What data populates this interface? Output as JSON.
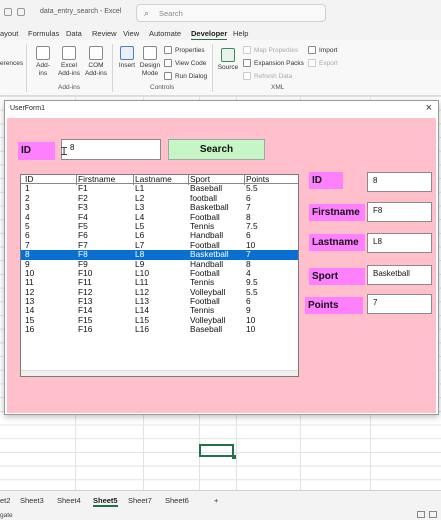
{
  "window": {
    "doc_title": "data_entry_search  -  Excel",
    "search_placeholder": "Search"
  },
  "ribbon_tabs": [
    "ayout",
    "Formulas",
    "Data",
    "Review",
    "View",
    "Automate",
    "Developer",
    "Help"
  ],
  "ribbon": {
    "references": "erences",
    "addins_btn": "Add-\nins",
    "excel_addins_btn": "Excel\nAdd-ins",
    "com_addins_btn": "COM\nAdd-ins",
    "addins_group": "Add-ins",
    "insert_btn": "Insert",
    "design_mode_btn": "Design\nMode",
    "properties": "Properties",
    "view_code": "View Code",
    "run_dialog": "Run Dialog",
    "controls_group": "Controls",
    "source_btn": "Source",
    "map_properties": "Map Properties",
    "expansion_packs": "Expansion Packs",
    "refresh_data": "Refresh Data",
    "import": "Import",
    "export": "Export",
    "xml_group": "XML"
  },
  "userform": {
    "title": "UserForm1",
    "close_glyph": "×",
    "id_label": "ID",
    "id_value": "8",
    "search_button": "Search",
    "detail": {
      "id_label": "ID",
      "id_value": "8",
      "firstname_label": "Firstname",
      "firstname_value": "F8",
      "lastname_label": "Lastname",
      "lastname_value": "L8",
      "sport_label": "Sport",
      "sport_value": "Basketball",
      "points_label": "Points",
      "points_value": "7"
    },
    "list": {
      "headers": [
        "ID",
        "Firstname",
        "Lastname",
        "Sport",
        "Points"
      ],
      "selected_index": 7,
      "rows": [
        [
          "1",
          "F1",
          "L1",
          "Baseball",
          "5.5"
        ],
        [
          "2",
          "F2",
          "L2",
          "football",
          "6"
        ],
        [
          "3",
          "F3",
          "L3",
          "Basketball",
          "7"
        ],
        [
          "4",
          "F4",
          "L4",
          "Football",
          "8"
        ],
        [
          "5",
          "F5",
          "L5",
          "Tennis",
          "7.5"
        ],
        [
          "6",
          "F6",
          "L6",
          "Handball",
          "6"
        ],
        [
          "7",
          "F7",
          "L7",
          "Football",
          "10"
        ],
        [
          "8",
          "F8",
          "L8",
          "Basketball",
          "7"
        ],
        [
          "9",
          "F9",
          "L9",
          "Handball",
          "8"
        ],
        [
          "10",
          "F10",
          "L10",
          "Football",
          "4"
        ],
        [
          "11",
          "F11",
          "L11",
          "Tennis",
          "9.5"
        ],
        [
          "12",
          "F12",
          "L12",
          "Volleyball",
          "5.5"
        ],
        [
          "13",
          "F13",
          "L13",
          "Football",
          "6"
        ],
        [
          "14",
          "F14",
          "L14",
          "Tennis",
          "9"
        ],
        [
          "15",
          "F15",
          "L15",
          "Volleyball",
          "10"
        ],
        [
          "16",
          "F16",
          "L16",
          "Baseball",
          "10"
        ]
      ]
    }
  },
  "sheet_tabs": [
    "et2",
    "Sheet3",
    "Sheet4",
    "Sheet5",
    "Sheet7",
    "Sheet6",
    "+"
  ],
  "active_sheet": "Sheet5",
  "status_text": "gate",
  "colors": {
    "form_bg": "#ffc0cb",
    "label_bg": "#ff80ff",
    "search_btn_bg": "#c6f5c6",
    "selection": "#0a6fd3",
    "excel_green": "#217346"
  }
}
